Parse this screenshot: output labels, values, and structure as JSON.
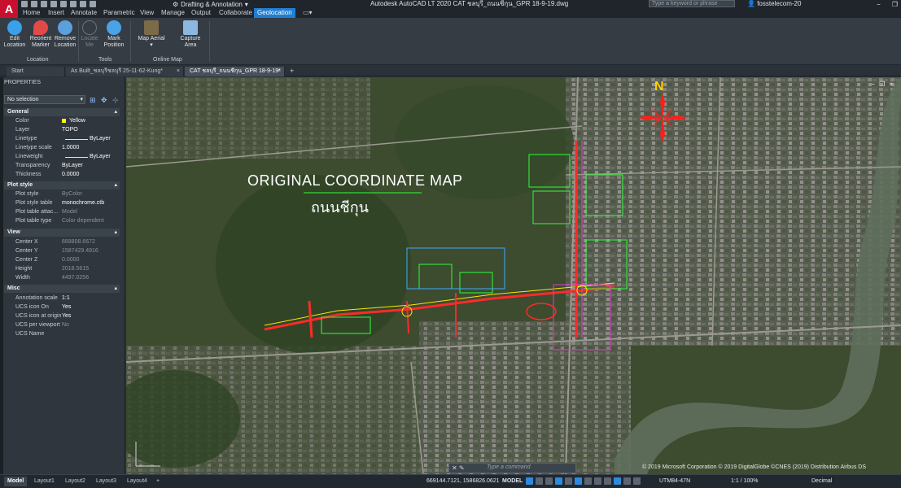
{
  "app": {
    "logo": "A",
    "title": "Autodesk AutoCAD LT 2020   CAT ชลบุรี_ถนนชีกุน_GPR 18-9-19.dwg",
    "workspace": "Drafting & Annotation",
    "search_placeholder": "Type a keyword or phrase",
    "user": "fosstelecom-20"
  },
  "ribbon_tabs": [
    "Home",
    "Insert",
    "Annotate",
    "Parametric",
    "View",
    "Manage",
    "Output",
    "Collaborate",
    "Geolocation"
  ],
  "ribbon": {
    "location_panel": {
      "label": "Location",
      "buttons": [
        {
          "l1": "Edit",
          "l2": "Location"
        },
        {
          "l1": "Reorient",
          "l2": "Marker"
        },
        {
          "l1": "Remove",
          "l2": "Location"
        }
      ]
    },
    "tools_panel": {
      "label": "Tools",
      "buttons": [
        {
          "l1": "Locate",
          "l2": "Me"
        },
        {
          "l1": "Mark",
          "l2": "Position"
        }
      ]
    },
    "online_map_panel": {
      "label": "Online Map",
      "buttons": [
        {
          "l1": "Map Aerial",
          "l2": ""
        },
        {
          "l1": "Capture",
          "l2": "Area"
        }
      ]
    }
  },
  "doc_tabs": [
    "Start",
    "As Built_ชลบุรีชลบุรี 25-11-62-Kung*",
    "CAT ชลบุรี_ถนนชีกุน_GPR 18-9-19*"
  ],
  "properties": {
    "title": "PROPERTIES",
    "selection": "No selection",
    "sections": {
      "general": {
        "title": "General",
        "color": {
          "k": "Color",
          "v": "Yellow"
        },
        "layer": {
          "k": "Layer",
          "v": "TOPO"
        },
        "linetype": {
          "k": "Linetype",
          "v": "ByLayer"
        },
        "ltscale": {
          "k": "Linetype scale",
          "v": "1.0000"
        },
        "lineweight": {
          "k": "Lineweight",
          "v": "ByLayer"
        },
        "transparency": {
          "k": "Transparency",
          "v": "ByLayer"
        },
        "thickness": {
          "k": "Thickness",
          "v": "0.0000"
        }
      },
      "plot": {
        "title": "Plot style",
        "style": {
          "k": "Plot style",
          "v": "ByColor"
        },
        "table": {
          "k": "Plot style table",
          "v": "monochrome.ctb"
        },
        "attach": {
          "k": "Plot table attac...",
          "v": "Model"
        },
        "type": {
          "k": "Plot table type",
          "v": "Color dependent"
        }
      },
      "view": {
        "title": "View",
        "cx": {
          "k": "Center X",
          "v": "668808.6672"
        },
        "cy": {
          "k": "Center Y",
          "v": "1587429.4916"
        },
        "cz": {
          "k": "Center Z",
          "v": "0.0000"
        },
        "height": {
          "k": "Height",
          "v": "2018.5615"
        },
        "width": {
          "k": "Width",
          "v": "4497.0256"
        }
      },
      "misc": {
        "title": "Misc",
        "annoscale": {
          "k": "Annotation scale",
          "v": "1:1"
        },
        "ucson": {
          "k": "UCS icon On",
          "v": "Yes"
        },
        "ucsorigin": {
          "k": "UCS icon at origin",
          "v": "Yes"
        },
        "ucsvp": {
          "k": "UCS per viewport",
          "v": "No"
        },
        "ucsname": {
          "k": "UCS Name",
          "v": ""
        }
      }
    }
  },
  "map": {
    "title": "ORIGINAL COORDINATE MAP",
    "subtitle": "ถนนชีกุน",
    "north": "N",
    "copyright": "© 2019 Microsoft Corporation © 2019 DigitalGlobe ©CNES (2019) Distribution Airbus DS"
  },
  "command_placeholder": "Type a command",
  "layout_tabs": [
    "Model",
    "Layout1",
    "Layout2",
    "Layout3",
    "Layout4"
  ],
  "status": {
    "coords": "669144.7121, 1586826.0621",
    "mode": "MODEL",
    "coord_system": "UTM84-47N",
    "scale": "1:1 / 100%",
    "units": "Decimal"
  }
}
